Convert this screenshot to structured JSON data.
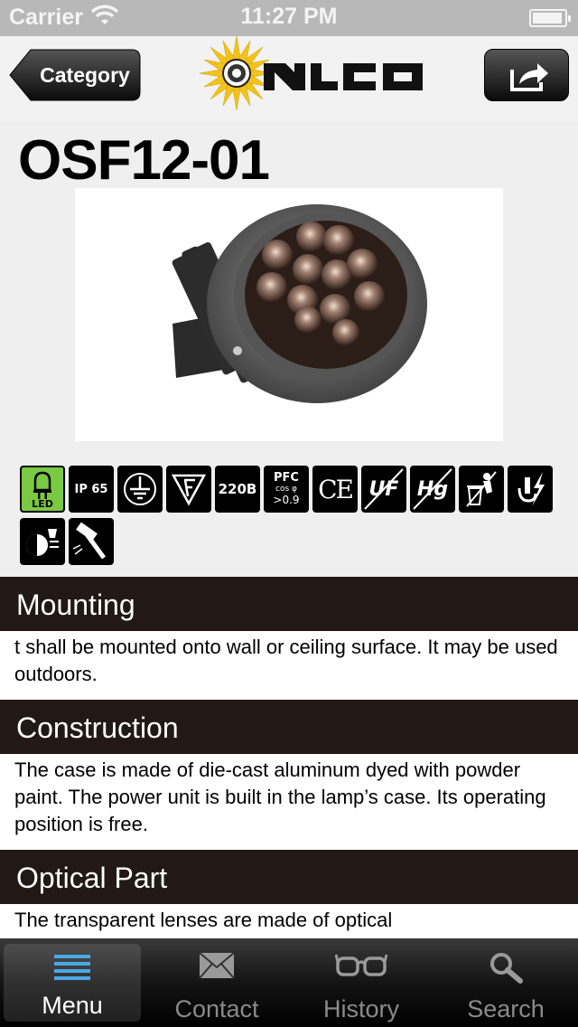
{
  "status_bar": {
    "carrier": "Carrier",
    "time": "11:27 PM"
  },
  "nav": {
    "back_label": "Category",
    "logo_text": "NLCO"
  },
  "product": {
    "title": "OSF12-01"
  },
  "badges": {
    "led": "LED",
    "ip": "IP 65",
    "voltage": "220B",
    "pfc_title": "PFC",
    "pfc_sub": "cos φ",
    "pfc_value": ">0.9",
    "ce": "CE",
    "uf": "UF",
    "hg": "Hg"
  },
  "sections": [
    {
      "title": "Mounting",
      "body": "t shall be mounted onto wall or ceiling surface. It may be used outdoors."
    },
    {
      "title": "Construction",
      "body": "The case is made of die-cast aluminum dyed with powder paint. The power unit is built in the lamp’s case. Its operating position is free."
    },
    {
      "title": "Optical Part",
      "body": "The transparent lenses are made of optical"
    }
  ],
  "tabs": [
    {
      "label": "Menu",
      "icon": "menu-icon",
      "active": true
    },
    {
      "label": "Contact",
      "icon": "envelope-icon",
      "active": false
    },
    {
      "label": "History",
      "icon": "glasses-icon",
      "active": false
    },
    {
      "label": "Search",
      "icon": "magnifier-icon",
      "active": false
    }
  ],
  "colors": {
    "section_header": "#221816",
    "tab_active_icon": "#4aa8e8",
    "logo_sun": "#f4c21a"
  }
}
